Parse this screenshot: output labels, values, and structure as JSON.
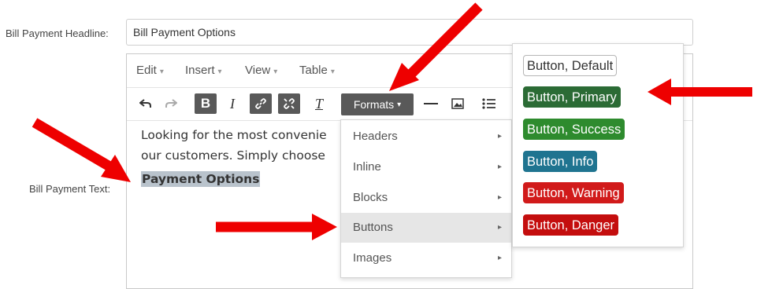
{
  "form": {
    "headline_label": "Bill Payment Headline:",
    "headline_value": "Bill Payment Options",
    "text_label": "Bill Payment Text:"
  },
  "editor": {
    "menus": [
      "Edit",
      "Insert",
      "View",
      "Table"
    ],
    "formats_label": "Formats",
    "content_line1": "Looking for the most convenie",
    "content_line2": "our customers. Simply choose",
    "content_heading": "Payment Options"
  },
  "formats_menu": {
    "items": [
      "Headers",
      "Inline",
      "Blocks",
      "Buttons",
      "Images"
    ],
    "active": "Buttons"
  },
  "buttons_submenu": {
    "items": [
      {
        "label": "Button, Default",
        "bg": "#ffffff",
        "fg": "#333333",
        "border": "#b5b5b5"
      },
      {
        "label": "Button, Primary",
        "bg": "#2b6b35",
        "fg": "#ffffff",
        "border": "#2b6b35"
      },
      {
        "label": "Button, Success",
        "bg": "#2e8b2e",
        "fg": "#ffffff",
        "border": "#2e8b2e"
      },
      {
        "label": "Button, Info",
        "bg": "#1f7490",
        "fg": "#ffffff",
        "border": "#1f7490"
      },
      {
        "label": "Button, Warning",
        "bg": "#d11a1a",
        "fg": "#ffffff",
        "border": "#d11a1a"
      },
      {
        "label": "Button, Danger",
        "bg": "#c40e0e",
        "fg": "#ffffff",
        "border": "#c40e0e"
      }
    ]
  },
  "annotations": {
    "arrow_color": "#ee0000"
  }
}
